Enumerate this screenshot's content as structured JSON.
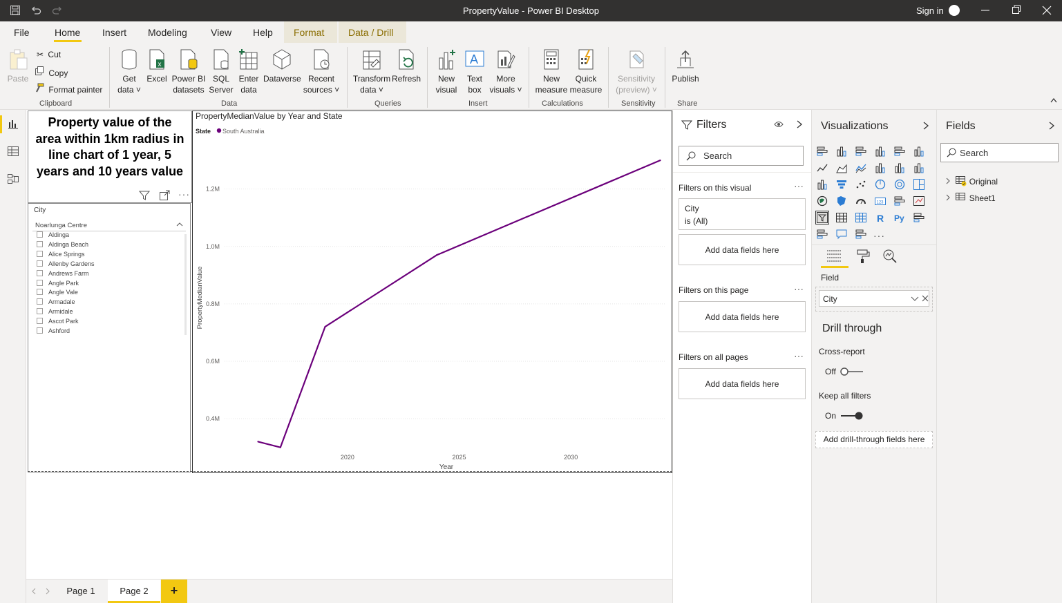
{
  "window": {
    "title": "PropertyValue - Power BI Desktop",
    "sign_in": "Sign in"
  },
  "menu": {
    "items": [
      "File",
      "Home",
      "Insert",
      "Modeling",
      "View",
      "Help"
    ],
    "context_tabs": [
      "Format",
      "Data / Drill"
    ]
  },
  "ribbon": {
    "clipboard": {
      "paste": "Paste",
      "cut": "Cut",
      "copy": "Copy",
      "format_painter": "Format painter",
      "label": "Clipboard"
    },
    "data": {
      "get_data": [
        "Get",
        "data ˅"
      ],
      "excel": "Excel",
      "pbi_datasets": [
        "Power BI",
        "datasets"
      ],
      "sql": [
        "SQL",
        "Server"
      ],
      "enter_data": [
        "Enter",
        "data"
      ],
      "dataverse": "Dataverse",
      "recent": [
        "Recent",
        "sources ˅"
      ],
      "label": "Data"
    },
    "queries": {
      "transform": [
        "Transform",
        "data ˅"
      ],
      "refresh": "Refresh",
      "label": "Queries"
    },
    "insert": {
      "new_visual": [
        "New",
        "visual"
      ],
      "text_box": [
        "Text",
        "box"
      ],
      "more_visuals": [
        "More",
        "visuals ˅"
      ],
      "label": "Insert"
    },
    "calculations": {
      "new_measure": [
        "New",
        "measure"
      ],
      "quick_measure": [
        "Quick",
        "measure"
      ],
      "label": "Calculations"
    },
    "sensitivity": {
      "btn": [
        "Sensitivity",
        "(preview) ˅"
      ],
      "label": "Sensitivity"
    },
    "share": {
      "publish": "Publish",
      "label": "Share"
    }
  },
  "card": {
    "title": "Property value of the area within 1km radius in line chart of 1 year, 5 years and 10 years value"
  },
  "slicer": {
    "header": "City",
    "selected": "Noarlunga Centre",
    "items": [
      "Aldinga",
      "Aldinga Beach",
      "Alice Springs",
      "Allenby Gardens",
      "Andrews Farm",
      "Angle Park",
      "Angle Vale",
      "Armadale",
      "Armidale",
      "Ascot Park",
      "Ashford"
    ]
  },
  "chart_data": {
    "type": "line",
    "title": "PropertyMedianValue by Year and State",
    "legend_title": "State",
    "xlabel": "Year",
    "ylabel": "PropertyMedianValue",
    "x_ticks": [
      "2020",
      "2025",
      "2030"
    ],
    "y_ticks": [
      "0.4M",
      "0.6M",
      "0.8M",
      "1.0M",
      "1.2M"
    ],
    "xlim": [
      2014.5,
      2034.2
    ],
    "ylim": [
      0.28,
      1.37
    ],
    "legend_position": "top-left",
    "grid": true,
    "series": [
      {
        "name": "South Australia",
        "color": "#6b007b",
        "x": [
          2016,
          2017,
          2019,
          2024,
          2034
        ],
        "y": [
          0.32,
          0.3,
          0.72,
          0.97,
          1.3
        ]
      }
    ]
  },
  "filters": {
    "title": "Filters",
    "search_placeholder": "Search",
    "on_visual": "Filters on this visual",
    "visual_filter": {
      "field": "City",
      "state": "is (All)"
    },
    "add_fields": "Add data fields here",
    "on_page": "Filters on this page",
    "on_all": "Filters on all pages"
  },
  "visualizations": {
    "title": "Visualizations",
    "field_label": "Field",
    "field_value": "City",
    "drill_title": "Drill through",
    "cross_report": "Cross-report",
    "cross_state": "Off",
    "keep_filters": "Keep all filters",
    "keep_state": "On",
    "add_drill": "Add drill-through fields here"
  },
  "fields_pane": {
    "title": "Fields",
    "search_placeholder": "Search",
    "tables": [
      "Original",
      "Sheet1"
    ]
  },
  "pages": {
    "tabs": [
      "Page 1",
      "Page 2"
    ],
    "active": "Page 2",
    "add": "+"
  }
}
